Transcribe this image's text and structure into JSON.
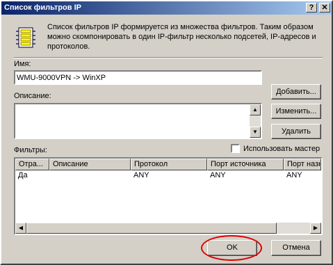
{
  "window": {
    "title": "Список фильтров IP",
    "help_glyph": "?",
    "close_glyph": "✕"
  },
  "description": "Список фильтров IP формируется из множества фильтров. Таким образом можно скомпонировать в один IP-фильтр несколько подсетей, IP-адресов и протоколов.",
  "name_field": {
    "label": "Имя:",
    "value": "WMU-9000VPN -> WinXP"
  },
  "description_field": {
    "label": "Описание:",
    "value": ""
  },
  "buttons": {
    "add": "Добавить...",
    "edit": "Изменить...",
    "delete": "Удалить",
    "ok": "OK",
    "cancel": "Отмена"
  },
  "filters": {
    "label": "Фильтры:",
    "use_wizard_label": "Использовать мастер",
    "use_wizard_checked": false,
    "columns": [
      "Отра...",
      "Описание",
      "Протокол",
      "Порт источника",
      "Порт назн"
    ],
    "rows": [
      {
        "mirrored": "Да",
        "description": "",
        "protocol": "ANY",
        "source_port": "ANY",
        "dest_port": "ANY"
      }
    ]
  },
  "icons": {
    "filter_list": "ip-filter-list-icon",
    "scroll_up": "arrow-up-icon",
    "scroll_down": "arrow-down-icon",
    "scroll_left": "arrow-left-icon",
    "scroll_right": "arrow-right-icon"
  },
  "colors": {
    "titlebar_start": "#0a246a",
    "titlebar_end": "#a6caf0",
    "face": "#d4d0c8",
    "highlight_ring": "#e00000"
  }
}
